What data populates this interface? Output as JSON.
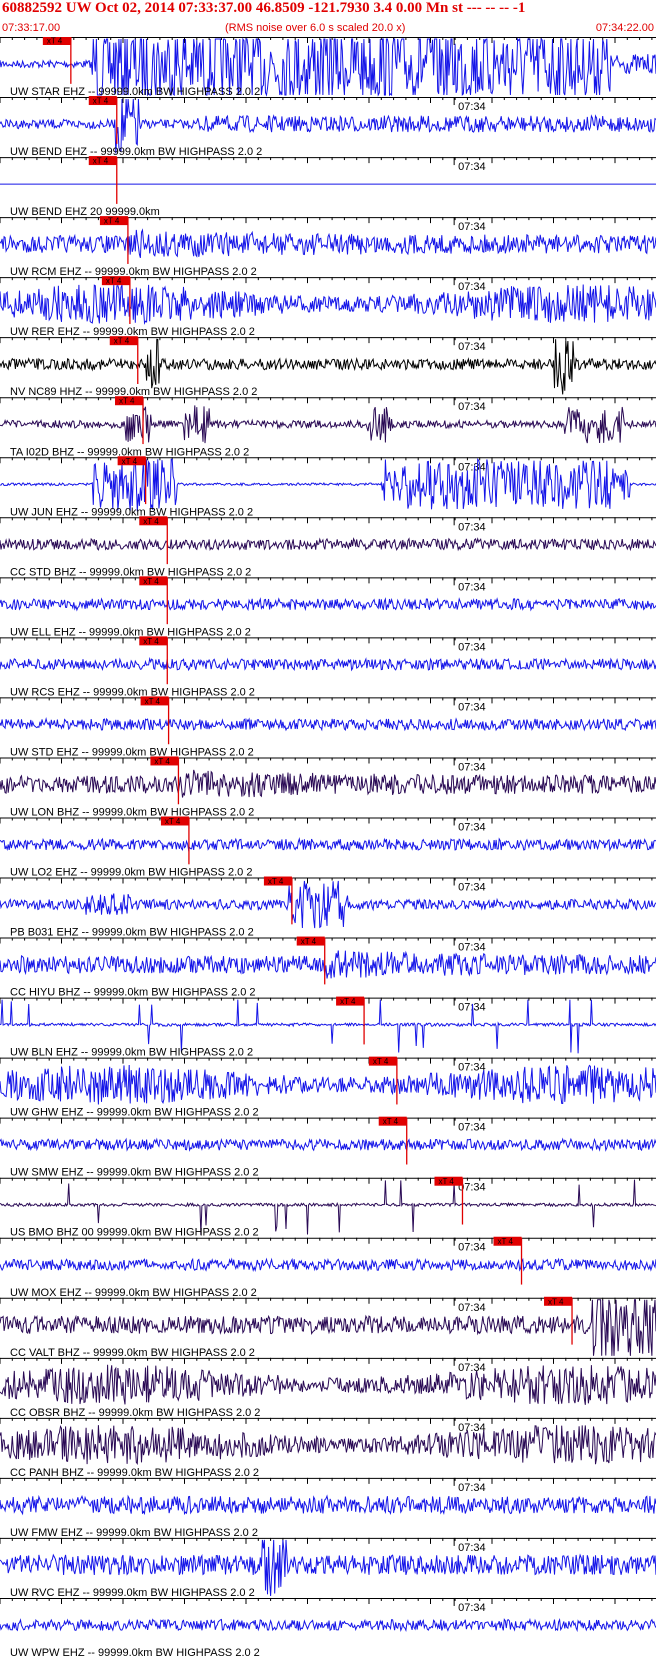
{
  "header": {
    "title": "60882592 UW Oct 02, 2014 07:33:37.00   46.8509 -121.7930  3.4 0.00 Mn st --- -- --  -1",
    "start_time": "07:33:17.00",
    "rms_note": "(RMS noise over 6.0 s scaled 20.0 x)",
    "end_time": "07:34:22.00"
  },
  "minute_label": "07:34",
  "pick_flag": "xT 4",
  "colors": {
    "blue": "#1515e8",
    "dark": "#2a0a55",
    "black": "#000000",
    "pick": "#e00000"
  },
  "traces": [
    {
      "label": "UW STAR EHZ -- 99999.0km BW  HIGHPASS  2.0  2",
      "color": "blue",
      "pick": 0.108,
      "style": "sat"
    },
    {
      "label": "UW BEND EHZ -- 99999.0km BW  HIGHPASS  2.0  2",
      "color": "blue",
      "pick": 0.178,
      "style": "burst_early"
    },
    {
      "label": "UW BEND EHZ 20 99999.0km",
      "color": "blue",
      "pick": 0.178,
      "style": "flat"
    },
    {
      "label": "UW RCM EHZ -- 99999.0km BW  HIGHPASS  2.0  2",
      "color": "blue",
      "pick": 0.195,
      "style": "med"
    },
    {
      "label": "UW RER EHZ -- 99999.0km BW  HIGHPASS  2.0  2",
      "color": "blue",
      "pick": 0.198,
      "style": "dense"
    },
    {
      "label": "NV NC89 HHZ -- 99999.0km BW  HIGHPASS  2.0  2",
      "color": "black",
      "pick": 0.21,
      "style": "spikes2"
    },
    {
      "label": "TA I02D BHZ -- 99999.0km BW  HIGHPASS  2.0  2",
      "color": "dark",
      "pick": 0.218,
      "style": "bursts"
    },
    {
      "label": "UW JUN EHZ -- 99999.0km BW  HIGHPASS  2.0  2",
      "color": "blue",
      "pick": 0.222,
      "style": "jun"
    },
    {
      "label": "CC STD BHZ -- 99999.0km BW  HIGHPASS  2.0  2",
      "color": "dark",
      "pick": 0.255,
      "style": "quiet"
    },
    {
      "label": "UW ELL EHZ -- 99999.0km BW  HIGHPASS  2.0  2",
      "color": "blue",
      "pick": 0.255,
      "style": "quiet"
    },
    {
      "label": "UW RCS EHZ -- 99999.0km BW  HIGHPASS  2.0  2",
      "color": "blue",
      "pick": 0.255,
      "style": "quiet"
    },
    {
      "label": "UW STD EHZ -- 99999.0km BW  HIGHPASS  2.0  2",
      "color": "blue",
      "pick": 0.257,
      "style": "quiet"
    },
    {
      "label": "UW LON BHZ -- 99999.0km BW  HIGHPASS  2.0  2",
      "color": "dark",
      "pick": 0.272,
      "style": "med"
    },
    {
      "label": "UW LO2 EHZ -- 99999.0km BW  HIGHPASS  2.0  2",
      "color": "blue",
      "pick": 0.288,
      "style": "quiet"
    },
    {
      "label": "PB B031 EHZ -- 99999.0km BW  HIGHPASS  2.0  2",
      "color": "blue",
      "pick": 0.445,
      "style": "b031"
    },
    {
      "label": "CC HIYU BHZ -- 99999.0km BW  HIGHPASS  2.0  2",
      "color": "blue",
      "pick": 0.495,
      "style": "med"
    },
    {
      "label": "UW BLN EHZ -- 99999.0km BW  HIGHPASS  2.0  2",
      "color": "blue",
      "pick": 0.555,
      "style": "spiky"
    },
    {
      "label": "UW GHW EHZ -- 99999.0km BW  HIGHPASS  2.0  2",
      "color": "blue",
      "pick": 0.605,
      "style": "dense"
    },
    {
      "label": "UW SMW EHZ -- 99999.0km BW  HIGHPASS  2.0  2",
      "color": "blue",
      "pick": 0.62,
      "style": "quiet"
    },
    {
      "label": "US BMO BHZ 00 99999.0km BW  HIGHPASS  2.0  2",
      "color": "dark",
      "pick": 0.705,
      "style": "spiky"
    },
    {
      "label": "UW MOX EHZ -- 99999.0km BW  HIGHPASS  2.0  2",
      "color": "blue",
      "pick": 0.795,
      "style": "quiet"
    },
    {
      "label": "CC VALT BHZ -- 99999.0km BW  HIGHPASS  2.0  2",
      "color": "dark",
      "pick": 0.872,
      "style": "valt"
    },
    {
      "label": "CC OBSR BHZ -- 99999.0km BW  HIGHPASS  2.0  2",
      "color": "dark",
      "pick": null,
      "style": "dense"
    },
    {
      "label": "CC PANH BHZ -- 99999.0km BW  HIGHPASS  2.0  2",
      "color": "dark",
      "pick": null,
      "style": "dense"
    },
    {
      "label": "UW FMW EHZ -- 99999.0km BW  HIGHPASS  2.0  2",
      "color": "blue",
      "pick": null,
      "style": "med"
    },
    {
      "label": "UW RVC EHZ -- 99999.0km BW  HIGHPASS  2.0  2",
      "color": "blue",
      "pick": null,
      "style": "rvc"
    },
    {
      "label": "UW WPW EHZ -- 99999.0km BW  HIGHPASS  2.0  2",
      "color": "blue",
      "pick": null,
      "style": "quiet"
    }
  ]
}
